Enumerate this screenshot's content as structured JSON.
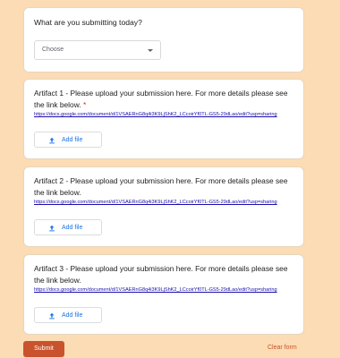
{
  "question": {
    "title": "What are you submitting today?",
    "dropdown_value": "Choose"
  },
  "artifacts": [
    {
      "title": "Artifact 1 - Please upload your submission here. For more details please see the link below.",
      "required_marker": "*",
      "link": "https://docs.google.com/document/d/1VSAERnG8q4i3K9LjShK2_LCcoirYf0TL-GS5-29dLao/edit?usp=sharing",
      "add_file_label": "Add file"
    },
    {
      "title": "Artifact 2 - Please upload your submission here. For more details please see the link below.",
      "link": "https://docs.google.com/document/d/1VSAERnG8q4i3K9LjShK2_LCcoirYf0TL-GS5-29dLao/edit?usp=sharing",
      "add_file_label": "Add file"
    },
    {
      "title": "Artifact 3 - Please upload your submission here. For more details please see the link below.",
      "link": "https://docs.google.com/document/d/1VSAERnG8q4i3K9LjShK2_LCcoirYf0TL-GS5-29dLao/edit?usp=sharing",
      "add_file_label": "Add file"
    }
  ],
  "footer": {
    "submit_label": "Submit",
    "clear_label": "Clear form"
  },
  "colors": {
    "background": "#fbdcb4",
    "accent": "#c9532c",
    "link": "#1a0dab",
    "button_text": "#1a73e8",
    "required": "#d93025"
  },
  "icons": {
    "dropdown": "chevron-down-icon",
    "upload": "upload-icon"
  }
}
